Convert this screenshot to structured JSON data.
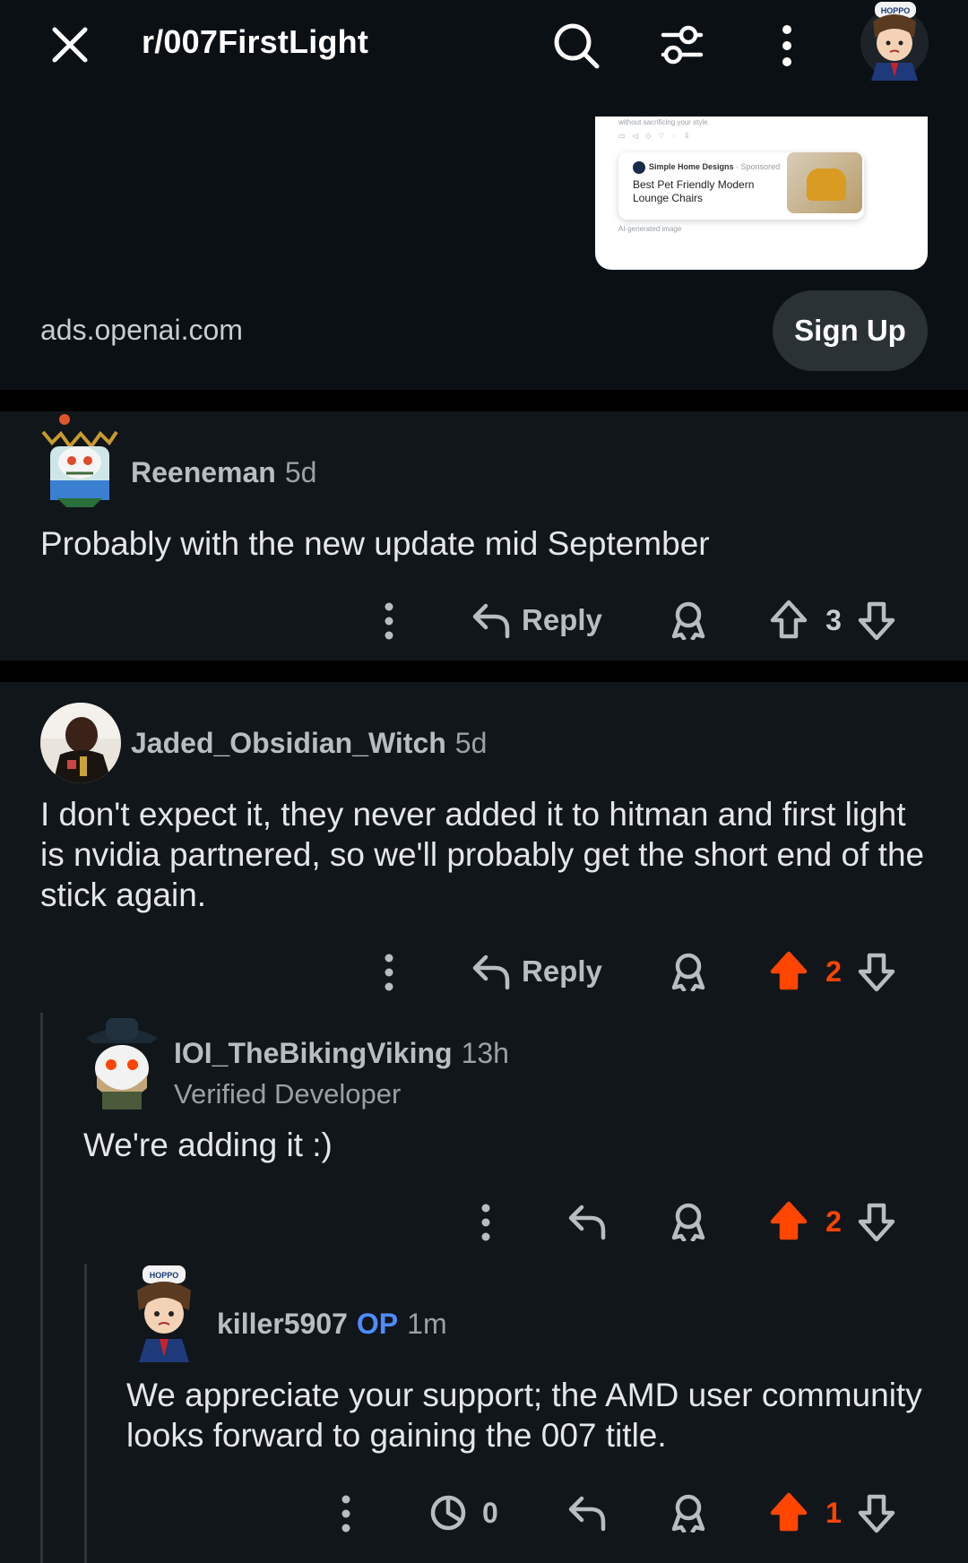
{
  "header": {
    "subreddit": "r/007FirstLight",
    "close_icon": "close-icon",
    "search_icon": "search-icon",
    "filter_icon": "filter-icon",
    "more_icon": "more-vertical-icon",
    "avatar_icon": "user-avatar"
  },
  "ad": {
    "card_top_text": "without sacrificing your style.",
    "sponsor_name": "Simple Home Designs",
    "sponsor_tag": "· Sponsored",
    "product_title": "Best Pet Friendly Modern Lounge Chairs",
    "card_footer": "AI-generated image",
    "domain": "ads.openai.com",
    "cta_label": "Sign Up"
  },
  "comments": [
    {
      "username": "Reeneman",
      "age": "5d",
      "body": "Probably with the new update mid September",
      "reply_label": "Reply",
      "score": "3",
      "upvoted": false
    },
    {
      "username": "Jaded_Obsidian_Witch",
      "age": "5d",
      "body": "I don't expect it, they never added it to hitman and first light is nvidia partnered, so we'll probably get the short end of the stick again.",
      "reply_label": "Reply",
      "score": "2",
      "upvoted": true
    },
    {
      "username": "IOI_TheBikingViking",
      "age": "13h",
      "flair": "Verified Developer",
      "body": "We're adding it :)",
      "score": "2",
      "upvoted": true
    },
    {
      "username": "killer5907",
      "op_badge": "OP",
      "age": "1m",
      "body": "We appreciate your support; the AMD user community looks forward to gaining the 007 title.",
      "views": "0",
      "score": "1",
      "upvoted": true
    }
  ],
  "colors": {
    "background": "#0b1015",
    "comment_bg": "#11161b",
    "upvote": "#ff4500",
    "op": "#4e8cff"
  }
}
